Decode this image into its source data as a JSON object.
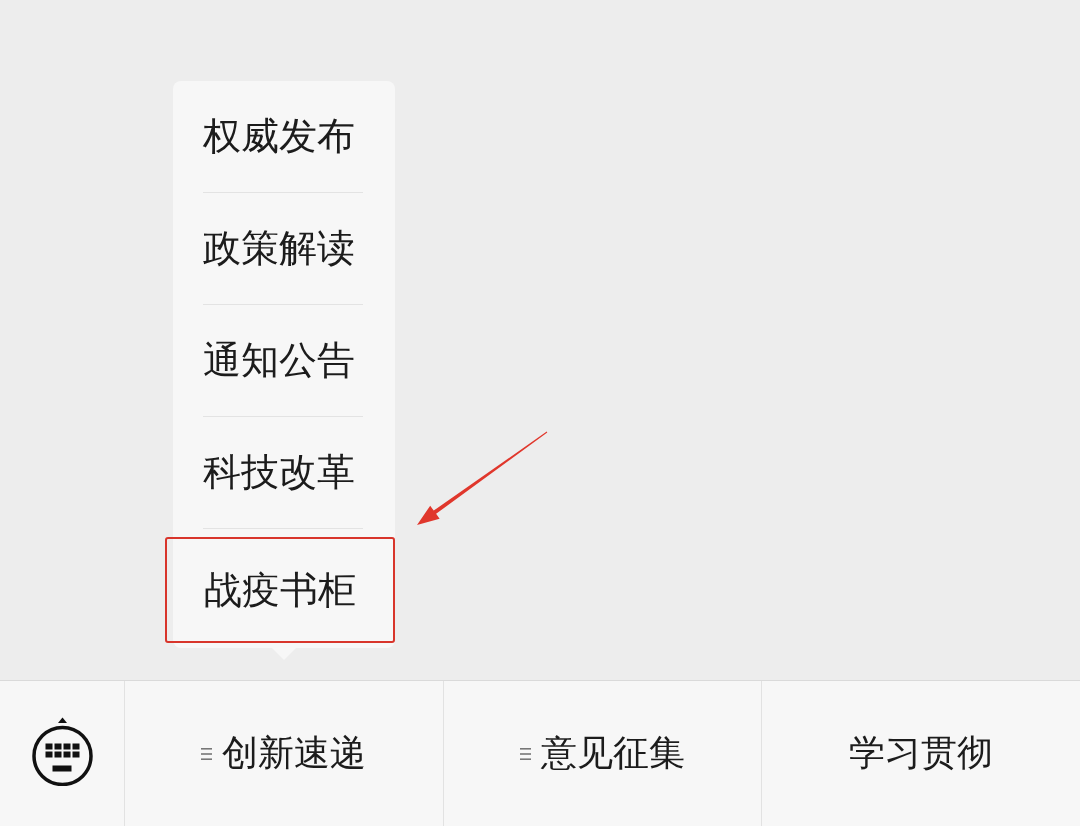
{
  "menu_bar": {
    "items": [
      {
        "label": "创新速递",
        "has_submenu": true,
        "submenu": [
          {
            "label": "权威发布",
            "highlighted": false
          },
          {
            "label": "政策解读",
            "highlighted": false
          },
          {
            "label": "通知公告",
            "highlighted": false
          },
          {
            "label": "科技改革",
            "highlighted": false
          },
          {
            "label": "战疫书柜",
            "highlighted": true
          }
        ]
      },
      {
        "label": "意见征集",
        "has_submenu": true
      },
      {
        "label": "学习贯彻",
        "has_submenu": false
      }
    ]
  }
}
